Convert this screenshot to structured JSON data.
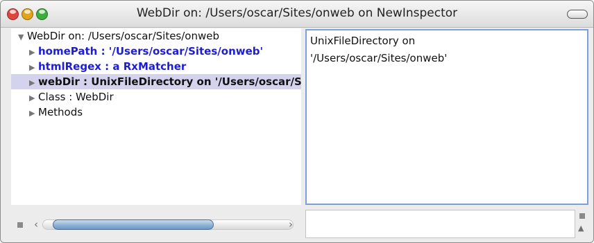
{
  "window": {
    "title": "WebDir on: /Users/oscar/Sites/onweb on NewInspector",
    "traffic_lights": {
      "close_color": "#e0443e",
      "minimize_color": "#e0a31a",
      "zoom_color": "#3cae3c"
    }
  },
  "tree": {
    "root": {
      "label": "WebDir on: /Users/oscar/Sites/onweb",
      "icon": "triangle-down-icon"
    },
    "items": [
      {
        "label": "homePath : '/Users/oscar/Sites/onweb'",
        "style": "blue-bold",
        "icon": "triangle-right-icon"
      },
      {
        "label": "htmlRegex : a RxMatcher",
        "style": "blue-bold",
        "icon": "triangle-right-icon"
      },
      {
        "label": "webDir : UnixFileDirectory on '/Users/oscar/Sites/onweb'",
        "style": "bold",
        "selected": true,
        "icon": "triangle-right-icon"
      },
      {
        "label": "Class : WebDir",
        "style": "normal",
        "icon": "triangle-right-icon"
      },
      {
        "label": "Methods",
        "style": "normal",
        "icon": "triangle-right-icon"
      }
    ]
  },
  "value_pane": {
    "line1": "UnixFileDirectory on",
    "line2": "'/Users/oscar/Sites/onweb'"
  },
  "colors": {
    "selection": "#d3d3ee",
    "link_blue": "#1d1dd6",
    "focus_border": "#7a9fdb"
  }
}
